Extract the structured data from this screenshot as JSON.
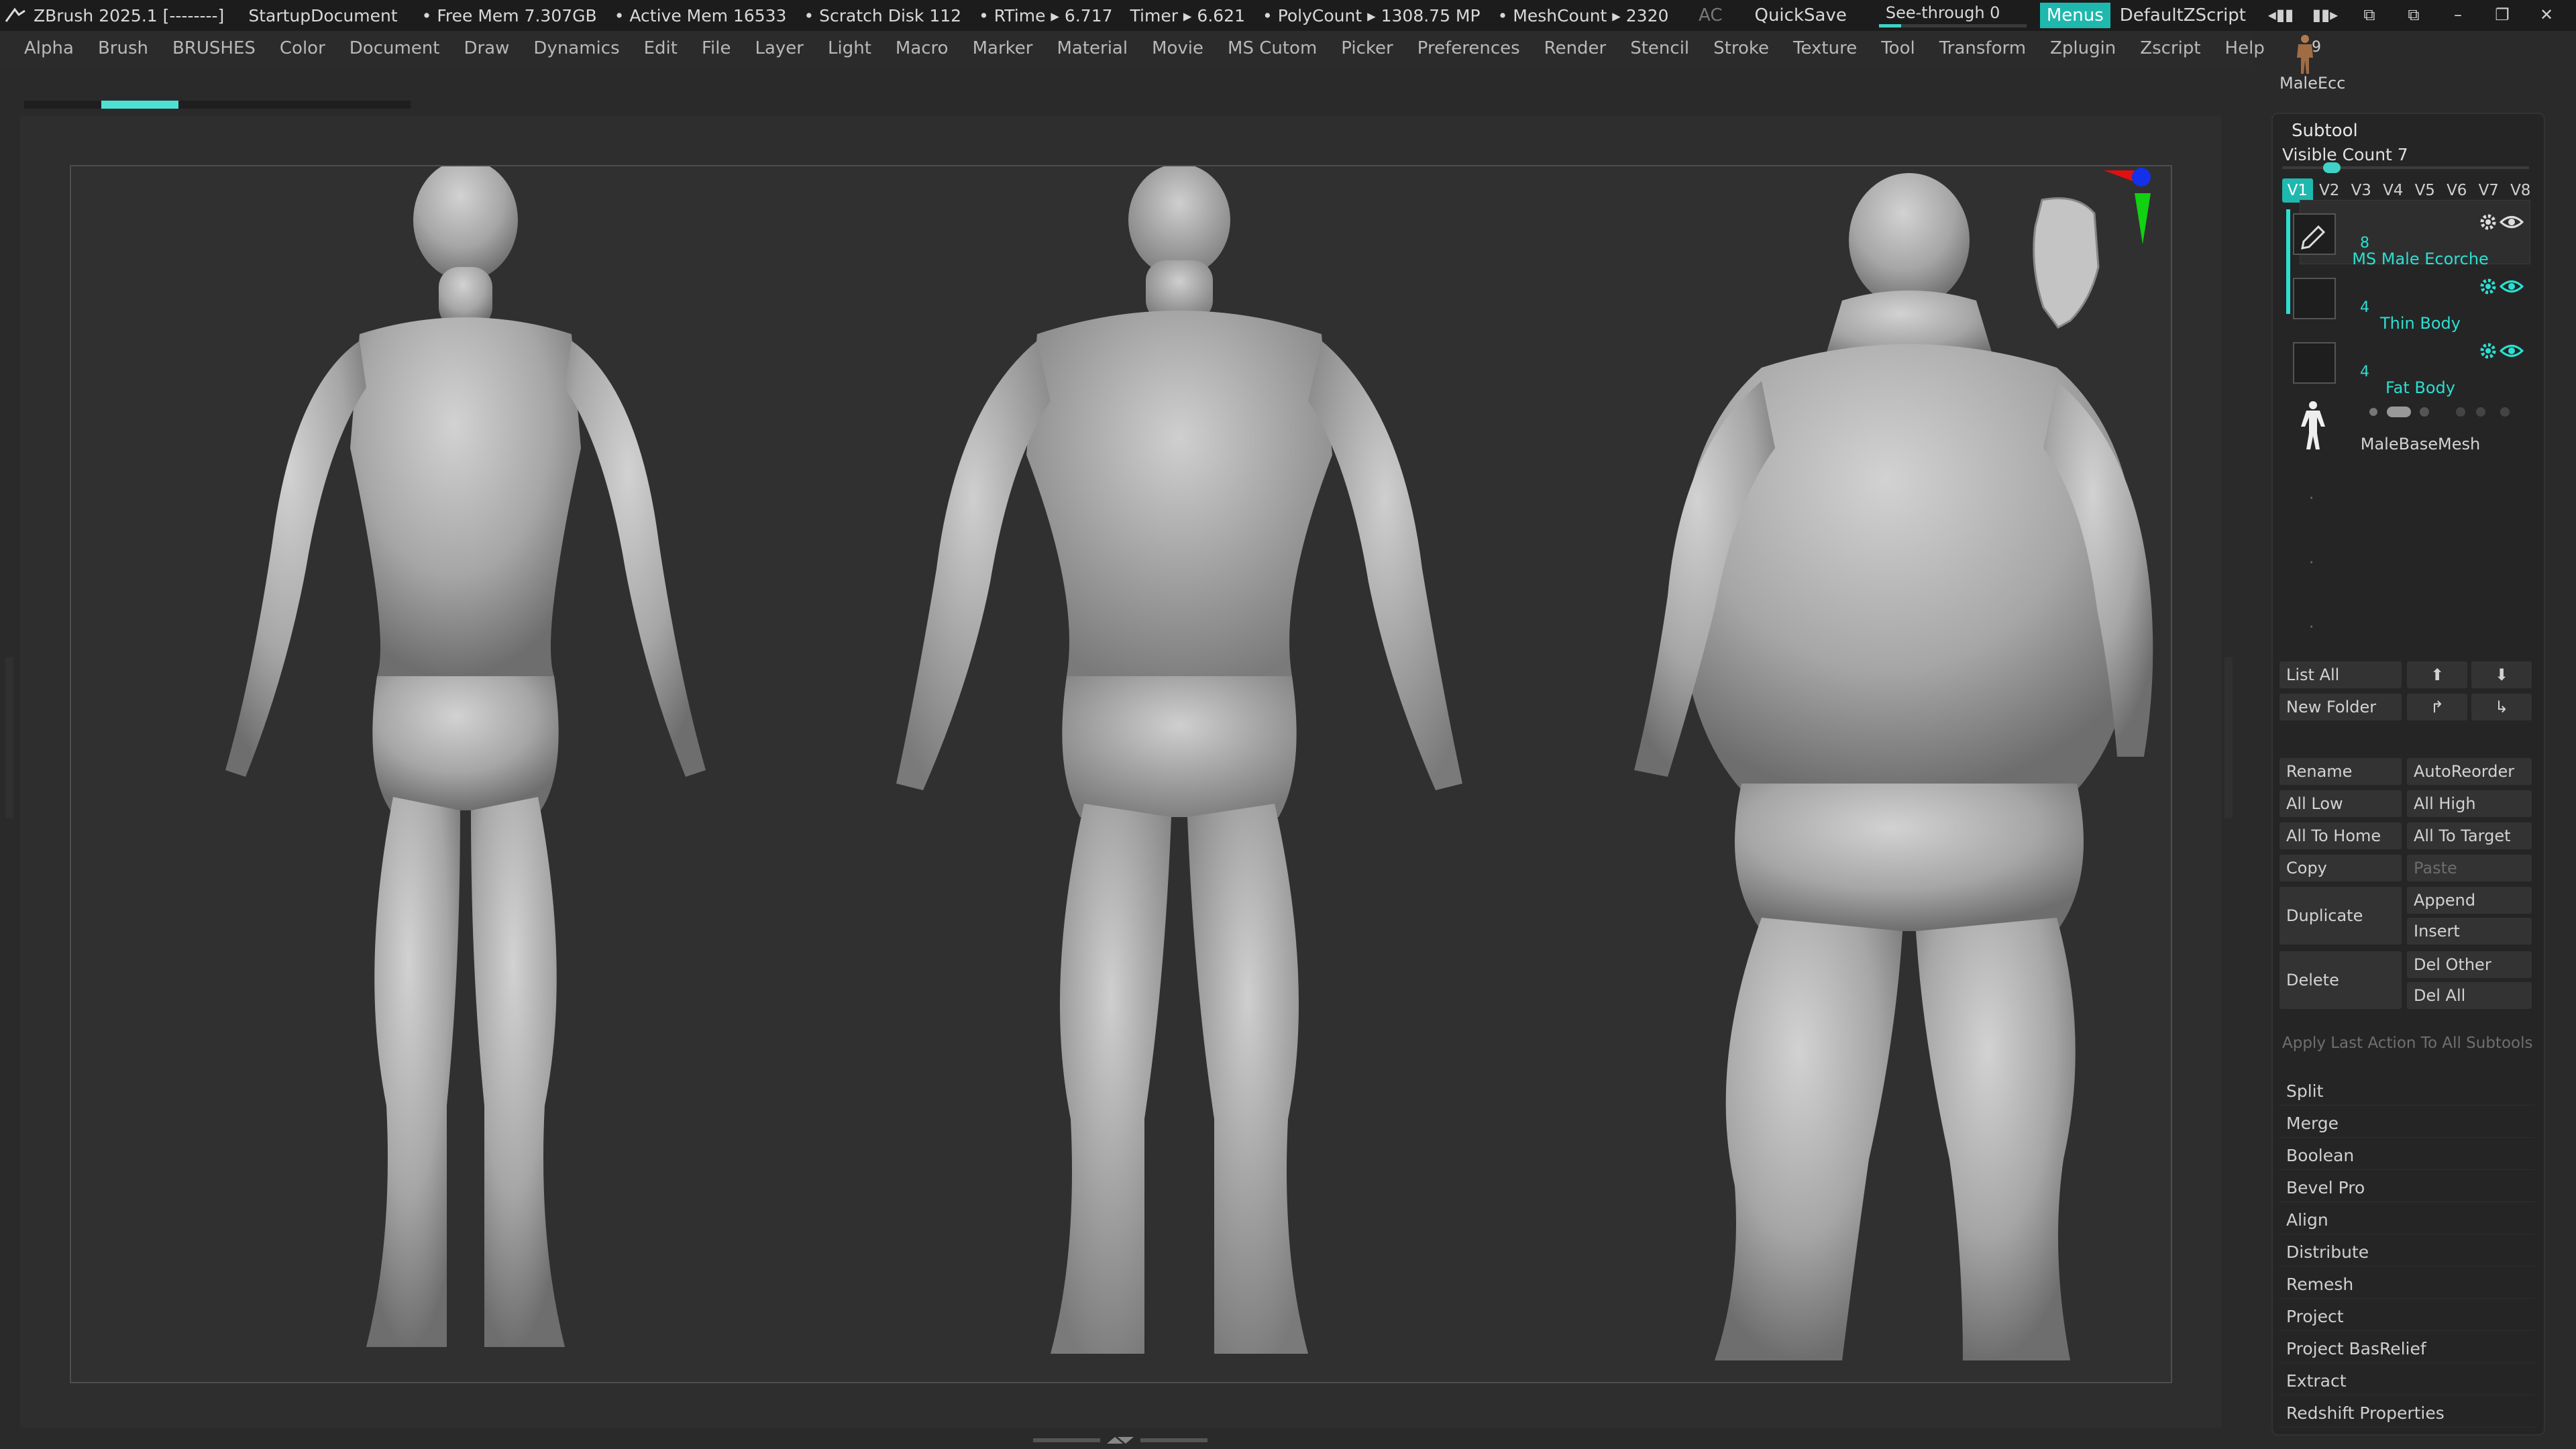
{
  "titlebar": {
    "app": "ZBrush 2025.1 [--------]",
    "document": "StartupDocument",
    "free_mem": "• Free Mem 7.307GB",
    "active_mem": "• Active Mem 16533",
    "scratch": "• Scratch Disk 112",
    "rtime": "• RTime ▸ 6.717",
    "timer": "Timer ▸ 6.621",
    "polycount": "• PolyCount ▸ 1308.75 MP",
    "meshcount": "• MeshCount ▸ 2320",
    "ac": "AC",
    "quicksave": "QuickSave",
    "see_through_label": "See-through  0",
    "see_through_value": 0.15,
    "menus": "Menus",
    "zscript": "DefaultZScript"
  },
  "menubar": [
    "Alpha",
    "Brush",
    "BRUSHES",
    "Color",
    "Document",
    "Draw",
    "Dynamics",
    "Edit",
    "File",
    "Layer",
    "Light",
    "Macro",
    "Marker",
    "Material",
    "Movie",
    "MS Cutom",
    "Picker",
    "Preferences",
    "Render",
    "Stencil",
    "Stroke",
    "Texture",
    "Tool",
    "Transform",
    "Zplugin",
    "Zscript",
    "Help"
  ],
  "progress": {
    "start": 0.2,
    "end": 0.4
  },
  "tool": {
    "count": "9",
    "name": "MaleEcc"
  },
  "subtool": {
    "title": "Subtool",
    "visible_count": "Visible Count 7",
    "visible_fraction": 0.2,
    "versions": [
      "V1",
      "V2",
      "V3",
      "V4",
      "V5",
      "V6",
      "V7",
      "V8"
    ],
    "active_version": "V1",
    "items": [
      {
        "count": "8",
        "name": "MS Male Ecorche"
      },
      {
        "count": "4",
        "name": "Thin Body"
      },
      {
        "count": "4",
        "name": "Fat Body"
      },
      {
        "count": "",
        "name": "MaleBaseMesh"
      }
    ]
  },
  "buttons": {
    "list_all": "List All",
    "new_folder": "New Folder",
    "rename": "Rename",
    "autoreorder": "AutoReorder",
    "all_low": "All Low",
    "all_high": "All High",
    "all_to_home": "All To Home",
    "all_to_target": "All To Target",
    "copy": "Copy",
    "paste": "Paste",
    "duplicate": "Duplicate",
    "append": "Append",
    "insert": "Insert",
    "delete": "Delete",
    "del_other": "Del Other",
    "del_all": "Del All",
    "apply_last": "Apply Last Action To All Subtools"
  },
  "sections": [
    "Split",
    "Merge",
    "Boolean",
    "Bevel Pro",
    "Align",
    "Distribute",
    "Remesh",
    "Project",
    "Project BasRelief",
    "Extract",
    "Redshift Properties"
  ],
  "colors": {
    "accent": "#1fb8ae",
    "accent_text": "#2ae0d2"
  },
  "icons": [
    "zbrush-logo-icon",
    "folder-icon",
    "gear-icon",
    "eye-icon",
    "arrow-up-icon",
    "arrow-down-icon",
    "move-icon",
    "brush-icon"
  ]
}
